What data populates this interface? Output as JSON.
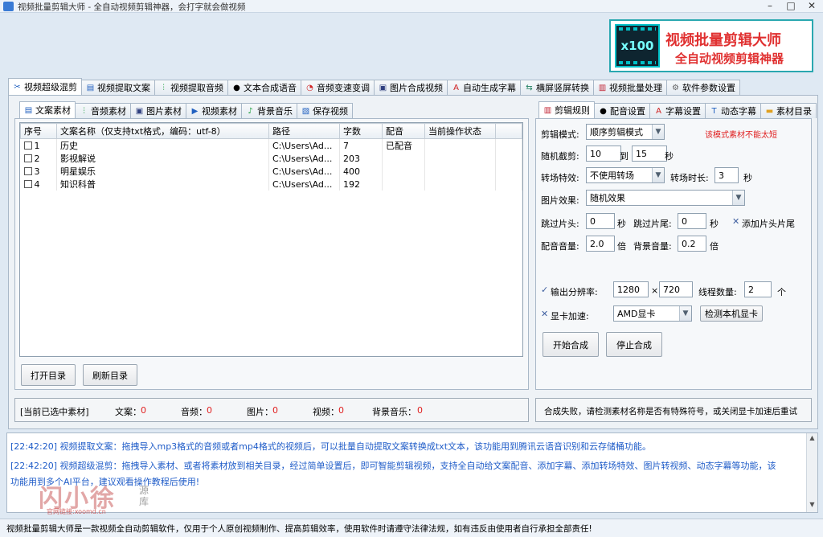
{
  "window": {
    "title": "视频批量剪辑大师 - 全自动视频剪辑神器，会打字就会做视频",
    "min": "–",
    "max": "□",
    "close": "✕"
  },
  "banner": {
    "badge": "x100",
    "line1": "视频批量剪辑大师",
    "line2": "全自动视频剪辑神器"
  },
  "main_tabs": [
    {
      "label": "视频超级混剪",
      "icon": "scissors-icon"
    },
    {
      "label": "视频提取文案",
      "icon": "document-icon"
    },
    {
      "label": "视频提取音频",
      "icon": "waveform-icon"
    },
    {
      "label": "文本合成语音",
      "icon": "microphone-icon"
    },
    {
      "label": "音频变速变调",
      "icon": "speedometer-icon"
    },
    {
      "label": "图片合成视频",
      "icon": "image-icon"
    },
    {
      "label": "自动生成字幕",
      "icon": "subtitle-icon"
    },
    {
      "label": "横屏竖屏转换",
      "icon": "rotate-screen-icon"
    },
    {
      "label": "视频批量处理",
      "icon": "film-icon"
    },
    {
      "label": "软件参数设置",
      "icon": "gear-icon"
    }
  ],
  "material_tabs": [
    {
      "label": "文案素材",
      "icon": "document-icon"
    },
    {
      "label": "音频素材",
      "icon": "waveform-icon"
    },
    {
      "label": "图片素材",
      "icon": "image-icon"
    },
    {
      "label": "视频素材",
      "icon": "play-icon"
    },
    {
      "label": "背景音乐",
      "icon": "music-note-icon"
    },
    {
      "label": "保存视频",
      "icon": "save-icon"
    }
  ],
  "table": {
    "headers": [
      "序号",
      "文案名称（仅支持txt格式，编码：utf-8）",
      "路径",
      "字数",
      "配音",
      "当前操作状态"
    ],
    "rows": [
      {
        "no": "1",
        "name": "历史",
        "path": "C:\\Users\\Ad...",
        "count": "7",
        "dub": "已配音",
        "status": ""
      },
      {
        "no": "2",
        "name": "影视解说",
        "path": "C:\\Users\\Ad...",
        "count": "203",
        "dub": "",
        "status": ""
      },
      {
        "no": "3",
        "name": "明星娱乐",
        "path": "C:\\Users\\Ad...",
        "count": "400",
        "dub": "",
        "status": ""
      },
      {
        "no": "4",
        "name": "知识科普",
        "path": "C:\\Users\\Ad...",
        "count": "192",
        "dub": "",
        "status": ""
      }
    ]
  },
  "buttons": {
    "open_dir": "打开目录",
    "refresh_dir": "刷新目录",
    "start": "开始合成",
    "stop": "停止合成",
    "detect_gpu": "检测本机显卡"
  },
  "selected": {
    "title": "[当前已选中素材]",
    "items": [
      {
        "label": "文案：",
        "value": "0"
      },
      {
        "label": "音频：",
        "value": "0"
      },
      {
        "label": "图片：",
        "value": "0"
      },
      {
        "label": "视频：",
        "value": "0"
      },
      {
        "label": "背景音乐：",
        "value": "0"
      }
    ]
  },
  "settings_tabs": [
    {
      "label": "剪辑规则",
      "icon": "film-icon"
    },
    {
      "label": "配音设置",
      "icon": "microphone-icon"
    },
    {
      "label": "字幕设置",
      "icon": "subtitle-icon"
    },
    {
      "label": "动态字幕",
      "icon": "text-icon"
    },
    {
      "label": "素材目录",
      "icon": "folder-icon"
    }
  ],
  "settings": {
    "mode_label": "剪辑模式:",
    "mode_value": "顺序剪辑模式",
    "mode_warning": "该模式素材不能太短",
    "random_cut_label": "随机截剪:",
    "random_from": "10",
    "random_to_label": "到",
    "random_to": "15",
    "sec": "秒",
    "transition_label": "转场特效:",
    "transition_value": "不使用转场",
    "transition_dur_label": "转场时长:",
    "transition_dur": "3",
    "image_effect_label": "图片效果:",
    "image_effect_value": "随机效果",
    "skip_head_label": "跳过片头:",
    "skip_head": "0",
    "skip_tail_label": "跳过片尾:",
    "skip_tail": "0",
    "add_head_tail": "添加片头片尾",
    "dub_vol_label": "配音音量:",
    "dub_vol": "2.0",
    "times": "倍",
    "bgm_vol_label": "背景音量:",
    "bgm_vol": "0.2",
    "resolution_label": "输出分辨率:",
    "res_w": "1280",
    "res_x": "×",
    "res_h": "720",
    "threads_label": "线程数量:",
    "threads": "2",
    "unit": "个",
    "gpu_label": "显卡加速:",
    "gpu_value": "AMD显卡"
  },
  "status_message": "合成失败，请检测素材名称是否有特殊符号，或关闭显卡加速后重试",
  "log": [
    "[22:42:20] 视频提取文案：拖拽导入mp3格式的音频或者mp4格式的视频后，可以批量自动提取文案转换成txt文本，该功能用到腾讯云语音识别和云存储桶功能。",
    "[22:42:20] 视频超级混剪：拖拽导入素材、或者将素材放到相关目录，经过简单设置后，即可智能剪辑视频，支持全自动给文案配音、添加字幕、添加转场特效、图片转视频、动态字幕等功能，该",
    "功能用到多个AI平台，建议观看操作教程后使用!"
  ],
  "watermark": {
    "big": "闪小徐",
    "side": "源库",
    "small": "官网链接:xoomd.cn"
  },
  "footer": "视频批量剪辑大师是一款视频全自动剪辑软件，仅用于个人原创视频制作、提高剪辑效率，使用软件时请遵守法律法规，如有违反由使用者自行承担全部责任!",
  "colors": {
    "accent": "#1f5cc8",
    "warning": "#e02020",
    "banner_border": "#2aa8b0"
  }
}
